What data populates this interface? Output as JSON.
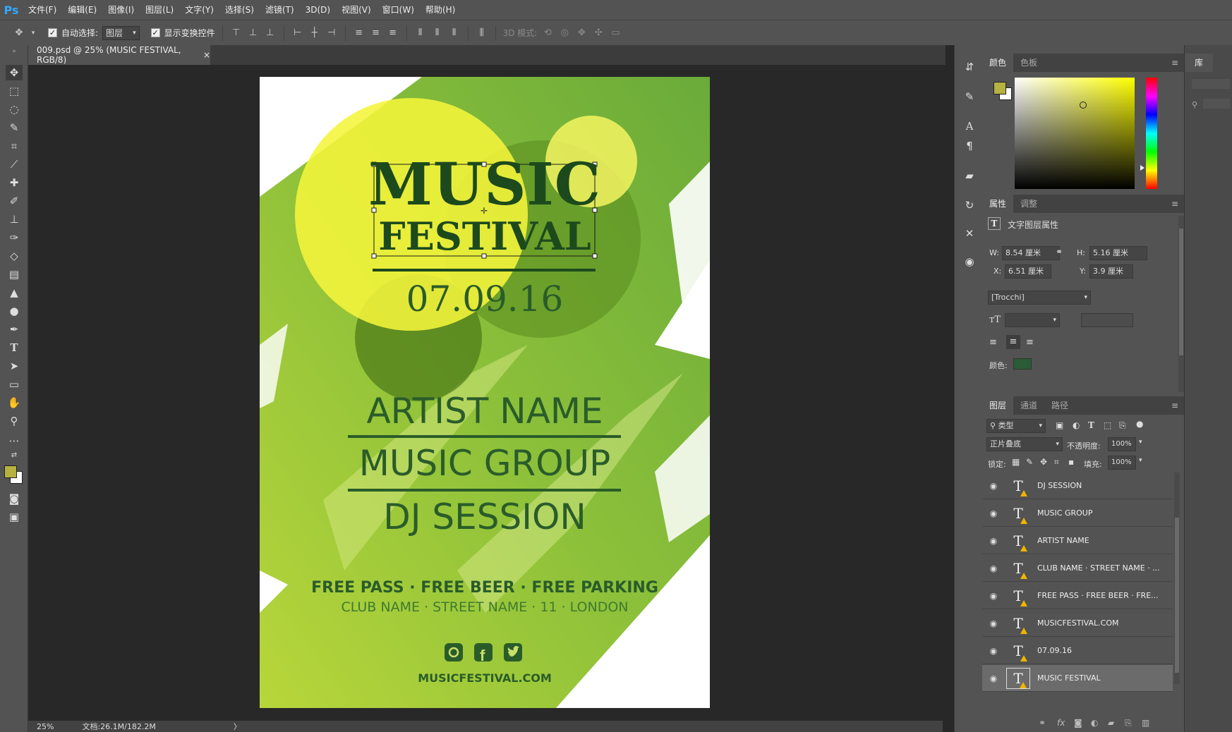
{
  "app": {
    "logo": "Ps"
  },
  "menu": [
    "文件(F)",
    "编辑(E)",
    "图像(I)",
    "图层(L)",
    "文字(Y)",
    "选择(S)",
    "滤镜(T)",
    "3D(D)",
    "视图(V)",
    "窗口(W)",
    "帮助(H)"
  ],
  "options": {
    "auto_select_label": "自动选择:",
    "auto_select_value": "图层",
    "show_transform_label": "显示变换控件",
    "mode3d_label": "3D 模式:"
  },
  "document": {
    "tab_title": "009.psd @ 25% (MUSIC FESTIVAL, RGB/8)",
    "close": "×"
  },
  "status": {
    "zoom": "25%",
    "doc_info": "文档:26.1M/182.2M",
    "arrow": "〉"
  },
  "poster": {
    "title1": "MUSIC",
    "title2": "FESTIVAL",
    "date": "07.09.16",
    "artist": "ARTIST NAME",
    "group": "MUSIC GROUP",
    "dj": "DJ SESSION",
    "free": "FREE PASS · FREE BEER · FREE PARKING",
    "club": "CLUB NAME · STREET NAME · 11 · LONDON",
    "website": "MUSICFESTIVAL.COM",
    "colors": {
      "dark_green": "#2a5c2a",
      "title_green": "#1d4a1d",
      "yellow": "#f2f23a",
      "brush": "#9cc63c"
    }
  },
  "color_panel": {
    "tabs": [
      "颜色",
      "色板"
    ],
    "fg_color": "#b5b23f",
    "bg_color": "#ffffff"
  },
  "library": {
    "title": "库"
  },
  "properties": {
    "tabs": [
      "属性",
      "调整"
    ],
    "header": "文字图层属性",
    "w_label": "W:",
    "w_value": "8.54 厘米",
    "h_label": "H:",
    "h_value": "5.16 厘米",
    "x_label": "X:",
    "x_value": "6.51 厘米",
    "y_label": "Y:",
    "y_value": "3.9 厘米",
    "font": "[Trocchi]",
    "color_label": "颜色:",
    "text_color": "#2a5c36"
  },
  "layers_panel": {
    "tabs": [
      "图层",
      "通道",
      "路径"
    ],
    "filter": "类型",
    "blend": "正片叠底",
    "opacity_label": "不透明度:",
    "opacity": "100%",
    "lock_label": "锁定:",
    "fill_label": "填充:",
    "fill": "100%",
    "layers": [
      {
        "name": "DJ SESSION"
      },
      {
        "name": "MUSIC GROUP"
      },
      {
        "name": "ARTIST NAME"
      },
      {
        "name": "CLUB NAME · STREET NAME · ..."
      },
      {
        "name": "FREE PASS · FREE BEER · FRE..."
      },
      {
        "name": "MUSICFESTIVAL.COM"
      },
      {
        "name": "07.09.16"
      },
      {
        "name": "MUSIC FESTIVAL"
      }
    ]
  }
}
